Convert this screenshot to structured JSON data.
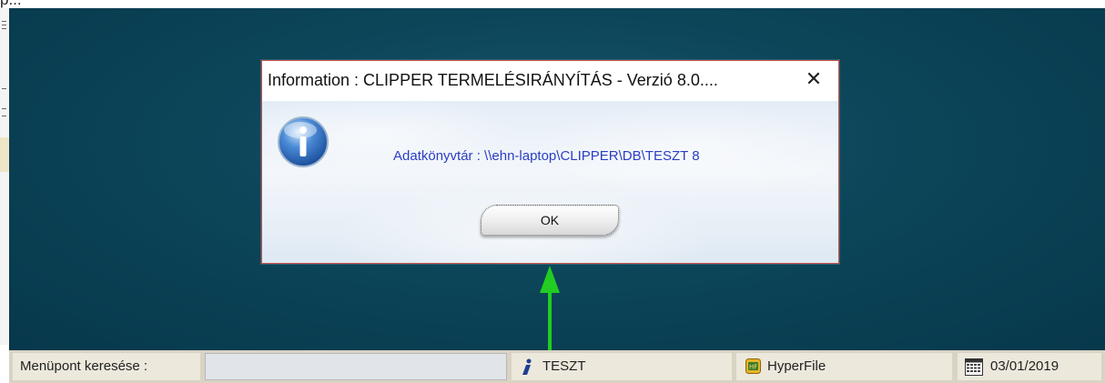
{
  "top_fragment": "p...",
  "dialog": {
    "title": "Information : CLIPPER TERMELÉSIRÁNYÍTÁS - Verzió 8.0....",
    "close_symbol": "✕",
    "message": "Adatkönyvtár : \\\\ehn-laptop\\CLIPPER\\DB\\TESZT 8",
    "ok_label": "OK",
    "icon": "info-icon"
  },
  "statusbar": {
    "search_label": "Menüpont keresése :",
    "search_value": "",
    "database": {
      "icon": "info-italic-icon",
      "label": "TESZT"
    },
    "engine": {
      "icon": "hyperfile-icon",
      "label": "HyperFile"
    },
    "date": {
      "icon": "calendar-icon",
      "label": "03/01/2019"
    }
  },
  "colors": {
    "desktop": "#0c4559",
    "dialog_border": "#c8504a",
    "message_text": "#2b3ec4",
    "arrow": "#22cc22",
    "statusbar": "#d9d3c4"
  }
}
